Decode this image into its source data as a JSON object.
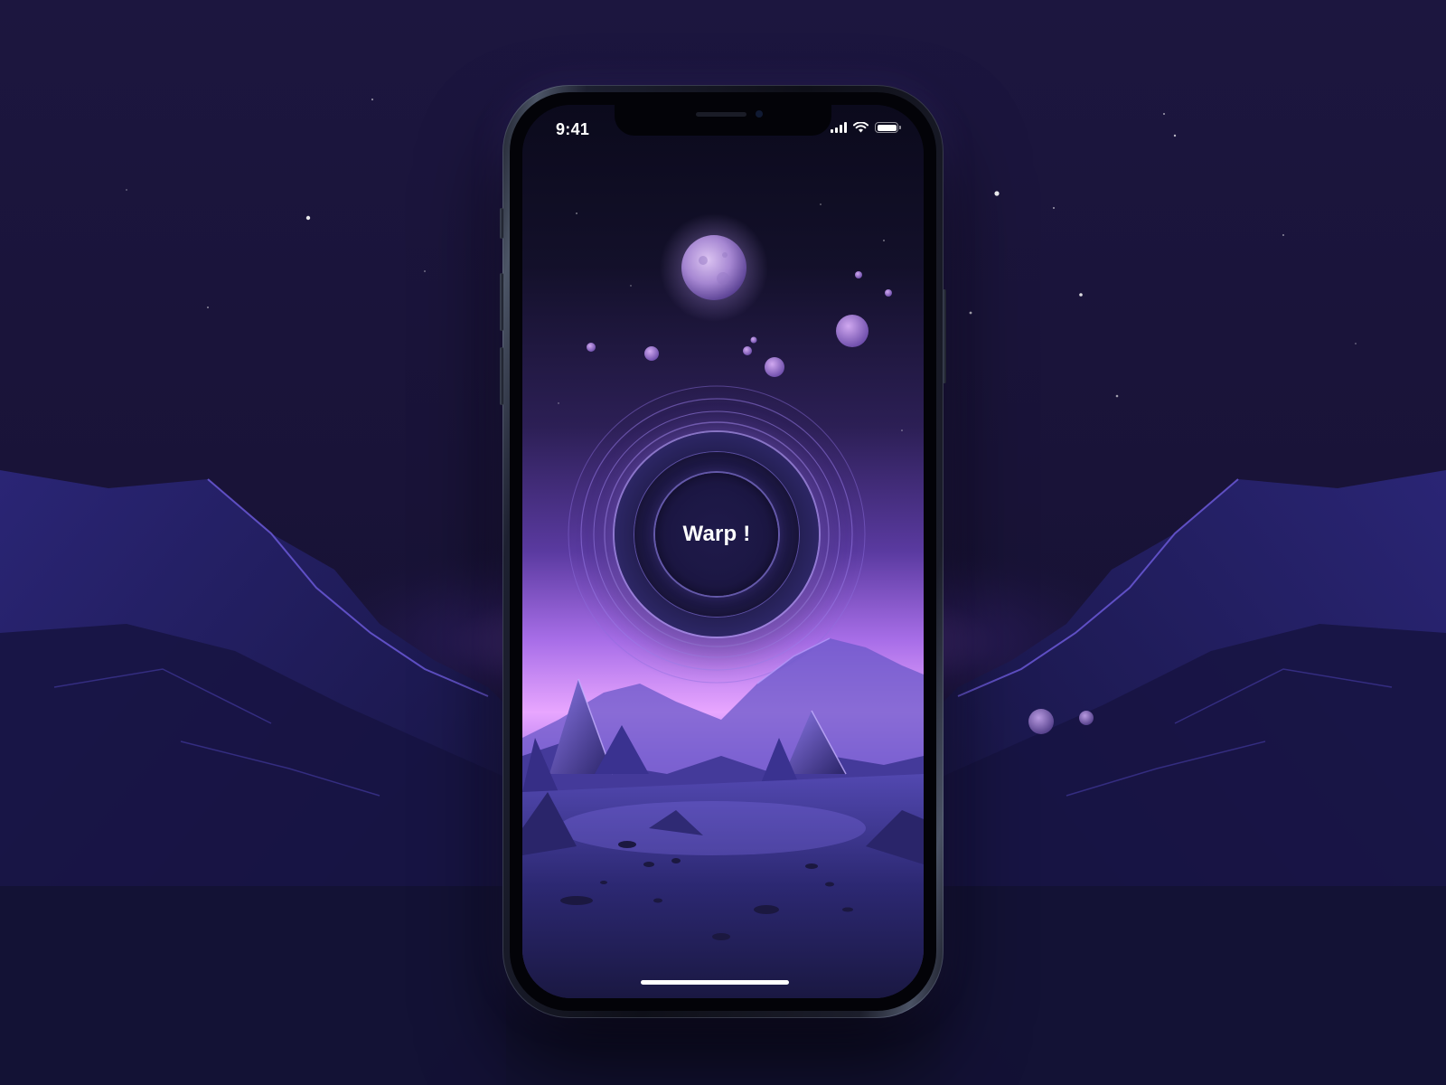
{
  "status_bar": {
    "time": "9:41",
    "signal_bars": 4,
    "wifi_icon": "wifi-icon",
    "battery_level": 1.0,
    "icons": [
      "signal-bars-icon",
      "wifi-icon",
      "battery-icon"
    ]
  },
  "main": {
    "warp_button_label": "Warp !"
  },
  "colors": {
    "background": "#17133a",
    "accent": "#8a6cff",
    "horizon_glow": "#e59cff",
    "button_face": "#1e1a46",
    "text": "#ffffff"
  }
}
